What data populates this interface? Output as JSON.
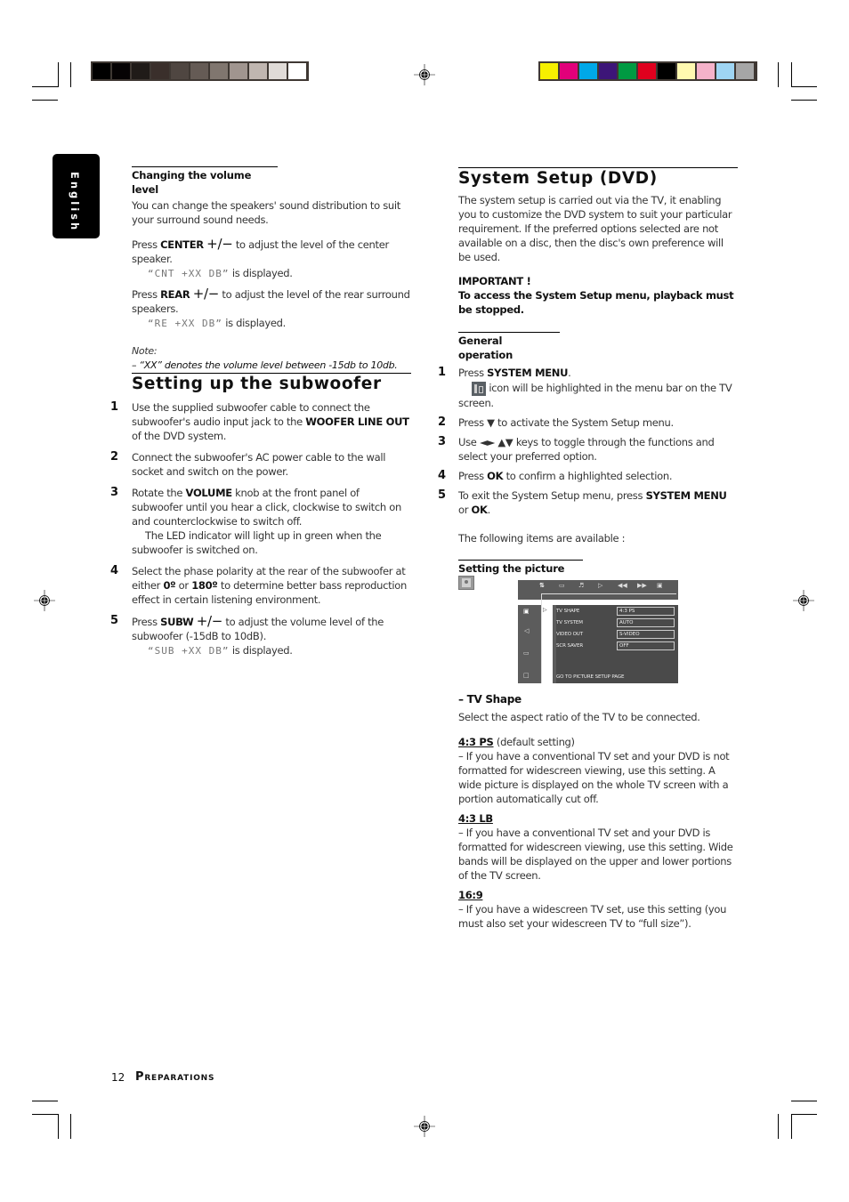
{
  "print_marks": {
    "grayscale_swatches": [
      "#000000",
      "#060304",
      "#201b18",
      "#3a2f2b",
      "#4f4641",
      "#655b55",
      "#80766f",
      "#a0958f",
      "#c0b6b0",
      "#e0dbd7",
      "#ffffff"
    ],
    "color_swatches": [
      "#f6f000",
      "#e2007a",
      "#00a8e8",
      "#3d1578",
      "#009a42",
      "#e0001e",
      "#000000",
      "#fff9b0",
      "#f5b2c9",
      "#9fd5f3",
      "#a6a6a6"
    ]
  },
  "language_tab": "English",
  "left_column": {
    "volume": {
      "heading": "Changing the volume level",
      "intro": "You can change the speakers' sound distribution to suit your surround sound needs.",
      "center": {
        "pre": "Press ",
        "key": "CENTER",
        "plusminus": "+/−",
        "post": " to adjust the level of the center speaker.",
        "display": "“CNT +XX DB”",
        "display_suffix": " is displayed."
      },
      "rear": {
        "pre": "Press ",
        "key": "REAR",
        "plusminus": "+/−",
        "post": " to adjust the level of the rear surround speakers.",
        "display": "“RE +XX DB”",
        "display_suffix": " is displayed."
      },
      "note_label": "Note:",
      "note_text": "–  “XX” denotes the volume level between -15db to 10db."
    },
    "subwoofer": {
      "heading": "Setting up the subwoofer",
      "steps": [
        {
          "n": "1",
          "a": "Use the supplied subwoofer cable to connect the subwoofer's audio input jack to the ",
          "b": "WOOFER LINE OUT",
          "c": " of the DVD system."
        },
        {
          "n": "2",
          "a": "Connect the subwoofer's AC power cable to the wall socket and switch on the power.",
          "b": "",
          "c": ""
        },
        {
          "n": "3",
          "a": "Rotate the ",
          "b": "VOLUME",
          "c": " knob at the front panel of subwoofer until you hear a click, clockwise to switch on and counterclockwise to switch off.",
          "d": "The LED indicator will light up in green when the subwoofer is switched on."
        },
        {
          "n": "4",
          "a": "Select the phase polarity at the rear of the subwoofer at either ",
          "b": "0º",
          "c": " or ",
          "d": "180º",
          "e": " to determine better bass reproduction effect in certain listening environment."
        },
        {
          "n": "5",
          "a": "Press ",
          "b": "SUBW",
          "pm": "+/−",
          "c": " to adjust the volume level of the subwoofer (-15dB to 10dB).",
          "display": "“SUB +XX DB”",
          "display_suffix": " is displayed."
        }
      ]
    }
  },
  "right_column": {
    "heading": "System Setup (DVD)",
    "intro": "The system setup is carried out via the TV, it enabling you to customize the DVD system to suit your particular requirement. If the preferred options selected are not available on a disc, then the disc's own preference will be used.",
    "important_label": "IMPORTANT !",
    "important_text": "To access the System Setup menu, playback must be stopped.",
    "general": {
      "heading": "General operation",
      "steps": [
        {
          "n": "1",
          "a": "Press ",
          "b": "SYSTEM MENU",
          "c": ".",
          "d": " icon will be highlighted in the menu bar on the TV screen."
        },
        {
          "n": "2",
          "a": "Press ▼ to activate the System Setup menu."
        },
        {
          "n": "3",
          "a": "Use ◄► ▲▼ keys to toggle through the functions and select your preferred option."
        },
        {
          "n": "4",
          "a": "Press ",
          "b": "OK",
          "c": " to confirm a highlighted selection."
        },
        {
          "n": "5",
          "a": "To exit the System Setup menu, press ",
          "b": "SYSTEM MENU",
          "c": " or ",
          "d": "OK",
          "e": "."
        }
      ]
    },
    "available": "The following items are available :",
    "picture": {
      "heading": "Setting the picture",
      "tv_menu": {
        "rows": [
          {
            "label": "TV SHAPE",
            "value": "4:3 PS"
          },
          {
            "label": "TV SYSTEM",
            "value": "AUTO"
          },
          {
            "label": "VIDEO OUT",
            "value": "S-VIDEO"
          },
          {
            "label": "SCR SAVER",
            "value": "OFF"
          }
        ],
        "footer": "GO TO PICTURE SETUP PAGE"
      },
      "tv_shape_heading": "–  TV Shape",
      "tv_shape_intro": "Select the aspect ratio of the TV to be connected.",
      "options": [
        {
          "label": "4:3 PS",
          "suffix": " (default setting)",
          "text": "–    If you have a conventional TV set and your DVD is not formatted for widescreen viewing, use this setting.  A wide picture is displayed on the whole TV screen with a portion automatically cut off."
        },
        {
          "label": "4:3 LB",
          "suffix": "",
          "text": "–    If you have a conventional TV set and your DVD is formatted for widescreen viewing, use this setting.  Wide bands will be displayed on the upper and lower portions of the TV screen."
        },
        {
          "label": "16:9",
          "suffix": "",
          "text": "–    If you have a widescreen TV set, use this setting (you must also set your widescreen TV to “full size”)."
        }
      ]
    }
  },
  "footer": {
    "page_number": "12",
    "section": "Preparations"
  }
}
